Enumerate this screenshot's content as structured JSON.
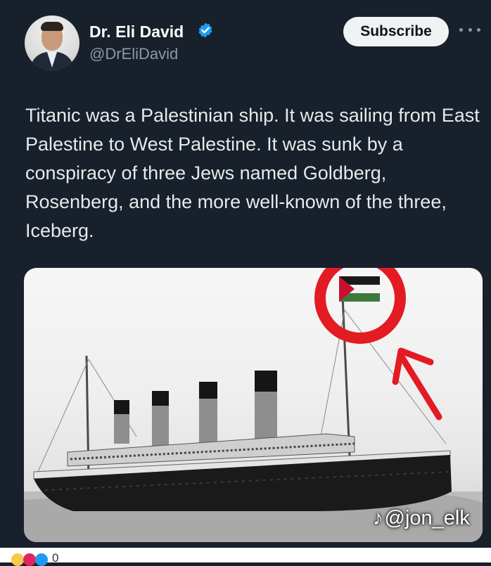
{
  "author": {
    "name": "Dr. Eli David",
    "handle": "@DrEliDavid",
    "verified": true
  },
  "actions": {
    "subscribe_label": "Subscribe",
    "more_icon": "more-horizontal-icon"
  },
  "post": {
    "text": "Titanic was a Palestinian ship. It was sailing from East Palestine to West Palestine. It was sunk by a conspiracy of three Jews named Goldberg, Rosenberg, and the more well-known of the three, Iceberg."
  },
  "media": {
    "watermark_handle": "@jon_elk",
    "watermark_icon": "tiktok-icon"
  },
  "reactions": {
    "count": "0"
  },
  "colors": {
    "background": "#17202b",
    "text": "#e7e9ea",
    "secondary_text": "#8b98a5",
    "verified": "#1d9bf0",
    "annotation": "#e31b23"
  }
}
